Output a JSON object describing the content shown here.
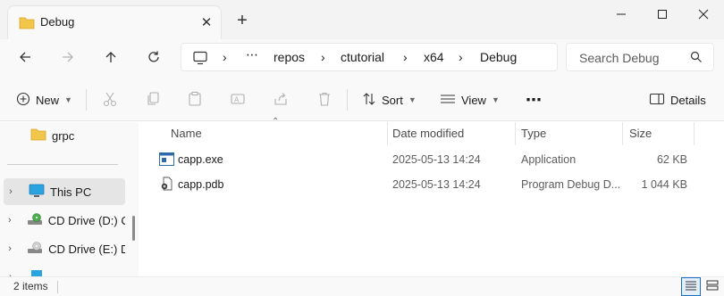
{
  "tab": {
    "title": "Debug"
  },
  "address": {
    "segments": [
      "repos",
      "ctutorial",
      "x64",
      "Debug"
    ],
    "overflow": "⋯",
    "separator": "›"
  },
  "search": {
    "placeholder": "Search Debug"
  },
  "toolbar": {
    "new_label": "New",
    "sort_label": "Sort",
    "view_label": "View",
    "more_label": "⋯",
    "details_label": "Details"
  },
  "nav": {
    "items": [
      {
        "label": "grpc"
      },
      {
        "label": "This PC"
      },
      {
        "label": "CD Drive (D:) CC"
      },
      {
        "label": "CD Drive (E:) Da"
      }
    ]
  },
  "columns": {
    "name": "Name",
    "date": "Date modified",
    "type": "Type",
    "size": "Size"
  },
  "files": [
    {
      "name": "capp.exe",
      "date": "2025-05-13 14:24",
      "type": "Application",
      "size": "62 KB"
    },
    {
      "name": "capp.pdb",
      "date": "2025-05-13 14:24",
      "type": "Program Debug D...",
      "size": "1 044 KB"
    }
  ],
  "status": {
    "items": "2 items"
  },
  "colors": {
    "folder": "#f2c54b",
    "accent": "#1a6fc4"
  }
}
